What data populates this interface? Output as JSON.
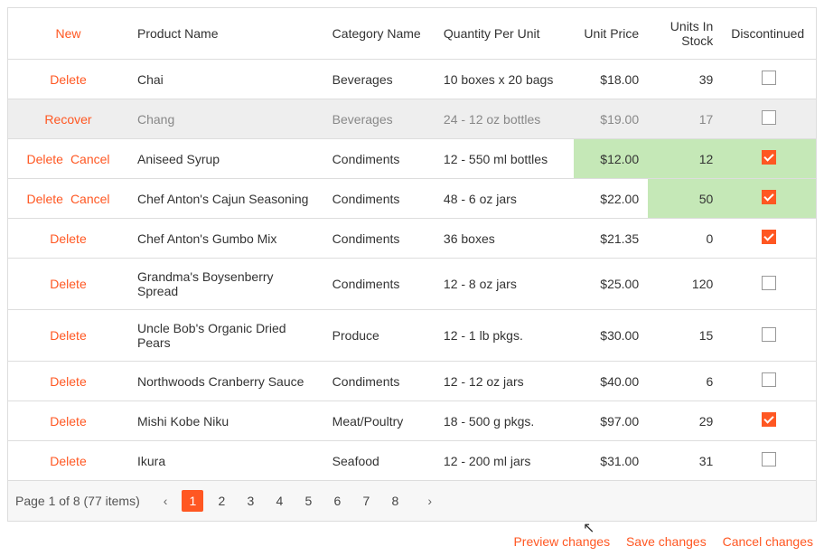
{
  "actions": {
    "new": "New",
    "delete": "Delete",
    "cancel": "Cancel",
    "recover": "Recover"
  },
  "columns": {
    "product_name": "Product Name",
    "category_name": "Category Name",
    "qty_per_unit": "Quantity Per Unit",
    "unit_price": "Unit Price",
    "units_in_stock": "Units In Stock",
    "discontinued": "Discontinued"
  },
  "rows": [
    {
      "actions": [
        "delete"
      ],
      "product_name": "Chai",
      "category": "Beverages",
      "qty": "10 boxes x 20 bags",
      "price": "$18.00",
      "stock": "39",
      "disc": false,
      "deleted": false,
      "changed": []
    },
    {
      "actions": [
        "recover"
      ],
      "product_name": "Chang",
      "category": "Beverages",
      "qty": "24 - 12 oz bottles",
      "price": "$19.00",
      "stock": "17",
      "disc": false,
      "deleted": true,
      "changed": []
    },
    {
      "actions": [
        "delete",
        "cancel"
      ],
      "product_name": "Aniseed Syrup",
      "category": "Condiments",
      "qty": "12 - 550 ml bottles",
      "price": "$12.00",
      "stock": "12",
      "disc": true,
      "deleted": false,
      "changed": [
        "price",
        "stock",
        "disc"
      ]
    },
    {
      "actions": [
        "delete",
        "cancel"
      ],
      "product_name": "Chef Anton's Cajun Seasoning",
      "category": "Condiments",
      "qty": "48 - 6 oz jars",
      "price": "$22.00",
      "stock": "50",
      "disc": true,
      "deleted": false,
      "changed": [
        "stock",
        "disc"
      ]
    },
    {
      "actions": [
        "delete"
      ],
      "product_name": "Chef Anton's Gumbo Mix",
      "category": "Condiments",
      "qty": "36 boxes",
      "price": "$21.35",
      "stock": "0",
      "disc": true,
      "deleted": false,
      "changed": []
    },
    {
      "actions": [
        "delete"
      ],
      "product_name": "Grandma's Boysenberry Spread",
      "category": "Condiments",
      "qty": "12 - 8 oz jars",
      "price": "$25.00",
      "stock": "120",
      "disc": false,
      "deleted": false,
      "changed": []
    },
    {
      "actions": [
        "delete"
      ],
      "product_name": "Uncle Bob's Organic Dried Pears",
      "category": "Produce",
      "qty": "12 - 1 lb pkgs.",
      "price": "$30.00",
      "stock": "15",
      "disc": false,
      "deleted": false,
      "changed": []
    },
    {
      "actions": [
        "delete"
      ],
      "product_name": "Northwoods Cranberry Sauce",
      "category": "Condiments",
      "qty": "12 - 12 oz jars",
      "price": "$40.00",
      "stock": "6",
      "disc": false,
      "deleted": false,
      "changed": []
    },
    {
      "actions": [
        "delete"
      ],
      "product_name": "Mishi Kobe Niku",
      "category": "Meat/Poultry",
      "qty": "18 - 500 g pkgs.",
      "price": "$97.00",
      "stock": "29",
      "disc": true,
      "deleted": false,
      "changed": []
    },
    {
      "actions": [
        "delete"
      ],
      "product_name": "Ikura",
      "category": "Seafood",
      "qty": "12 - 200 ml jars",
      "price": "$31.00",
      "stock": "31",
      "disc": false,
      "deleted": false,
      "changed": []
    }
  ],
  "pager": {
    "info": "Page 1 of 8 (77 items)",
    "prev": "‹",
    "next": "›",
    "pages": [
      "1",
      "2",
      "3",
      "4",
      "5",
      "6",
      "7",
      "8"
    ],
    "active": "1"
  },
  "footer": {
    "preview": "Preview changes",
    "save": "Save changes",
    "cancel": "Cancel changes"
  }
}
